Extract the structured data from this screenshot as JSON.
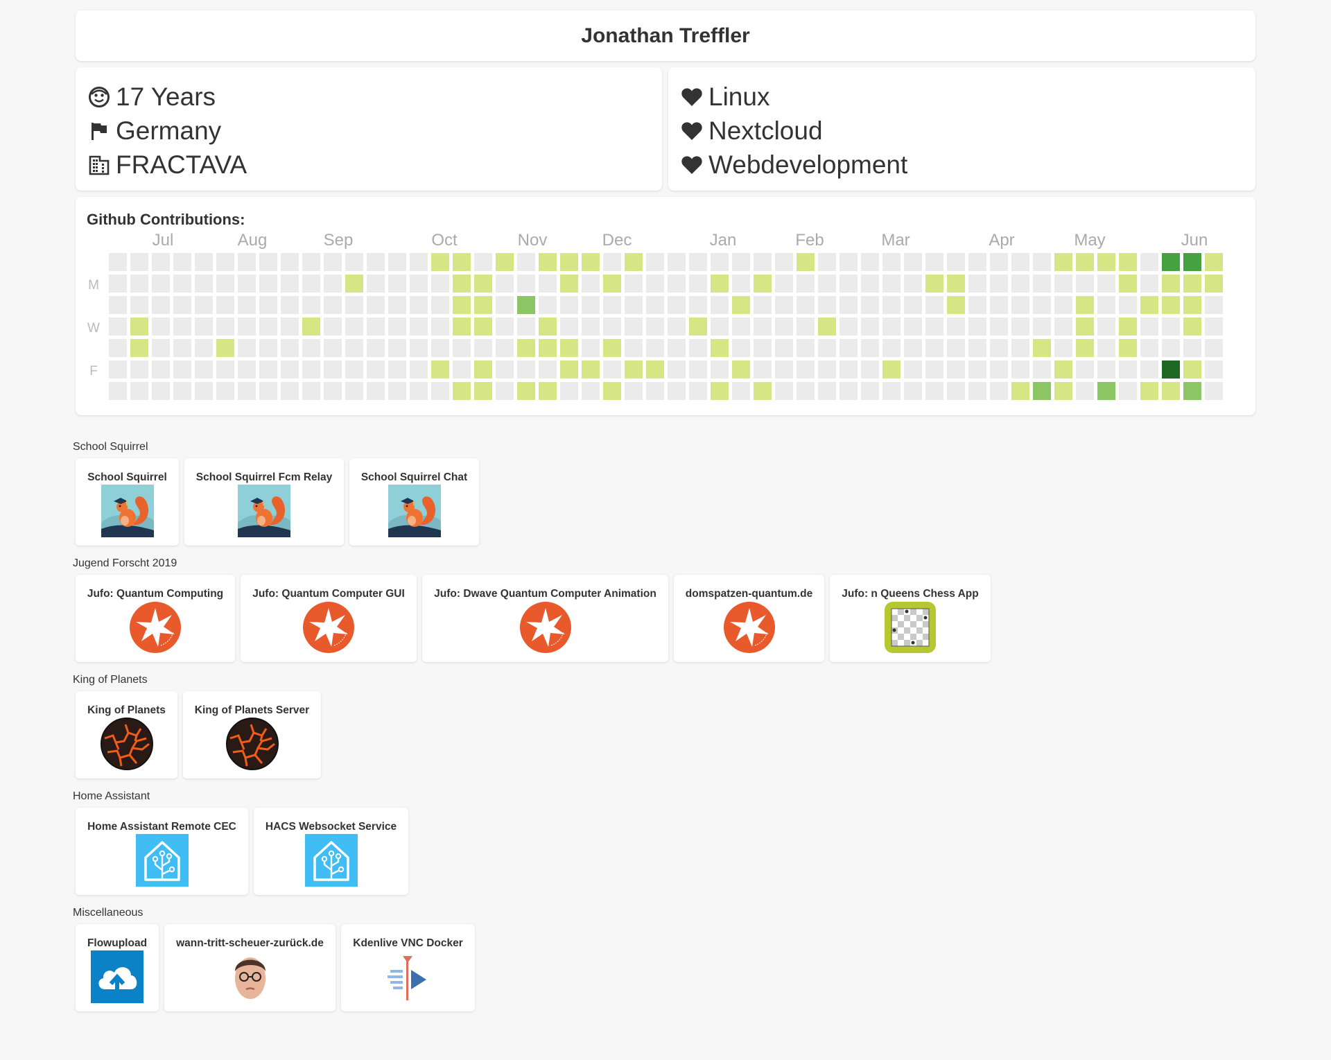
{
  "header": {
    "name": "Jonathan Treffler"
  },
  "info_left": [
    {
      "icon": "smiley-face-icon",
      "text": "17 Years"
    },
    {
      "icon": "flag-icon",
      "text": "Germany"
    },
    {
      "icon": "office-building-icon",
      "text": "FRACTAVA"
    }
  ],
  "info_right": [
    {
      "icon": "heart-icon",
      "text": "Linux"
    },
    {
      "icon": "heart-icon",
      "text": "Nextcloud"
    },
    {
      "icon": "heart-icon",
      "text": "Webdevelopment"
    }
  ],
  "contributions": {
    "title": "Github Contributions:",
    "months": [
      "Jul",
      "Aug",
      "Sep",
      "Oct",
      "Nov",
      "Dec",
      "Jan",
      "Feb",
      "Mar",
      "Apr",
      "May",
      "Jun"
    ],
    "days": [
      "M",
      "W",
      "F"
    ],
    "colors": [
      "#ebebeb",
      "#d6e685",
      "#8cc665",
      "#44a340",
      "#1e6823"
    ],
    "weeks": [
      [
        0,
        0,
        0,
        0,
        0,
        0,
        0
      ],
      [
        0,
        0,
        0,
        1,
        1,
        0,
        0
      ],
      [
        0,
        0,
        0,
        0,
        0,
        0,
        0
      ],
      [
        0,
        0,
        0,
        0,
        0,
        0,
        0
      ],
      [
        0,
        0,
        0,
        0,
        0,
        0,
        0
      ],
      [
        0,
        0,
        0,
        0,
        1,
        0,
        0
      ],
      [
        0,
        0,
        0,
        0,
        0,
        0,
        0
      ],
      [
        0,
        0,
        0,
        0,
        0,
        0,
        0
      ],
      [
        0,
        0,
        0,
        0,
        0,
        0,
        0
      ],
      [
        0,
        0,
        0,
        1,
        0,
        0,
        0
      ],
      [
        0,
        0,
        0,
        0,
        0,
        0,
        0
      ],
      [
        0,
        1,
        0,
        0,
        0,
        0,
        0
      ],
      [
        0,
        0,
        0,
        0,
        0,
        0,
        0
      ],
      [
        0,
        0,
        0,
        0,
        0,
        0,
        0
      ],
      [
        0,
        0,
        0,
        0,
        0,
        0,
        0
      ],
      [
        1,
        0,
        0,
        0,
        0,
        1,
        0
      ],
      [
        1,
        1,
        1,
        1,
        0,
        0,
        1
      ],
      [
        0,
        1,
        1,
        1,
        0,
        1,
        1
      ],
      [
        1,
        0,
        0,
        0,
        0,
        0,
        0
      ],
      [
        0,
        0,
        2,
        0,
        1,
        0,
        1
      ],
      [
        1,
        0,
        0,
        1,
        1,
        0,
        1
      ],
      [
        1,
        1,
        0,
        0,
        1,
        1,
        0
      ],
      [
        1,
        0,
        0,
        0,
        0,
        1,
        0
      ],
      [
        0,
        1,
        0,
        0,
        1,
        0,
        1
      ],
      [
        1,
        0,
        0,
        0,
        0,
        1,
        0
      ],
      [
        0,
        0,
        0,
        0,
        0,
        1,
        0
      ],
      [
        0,
        0,
        0,
        0,
        0,
        0,
        0
      ],
      [
        0,
        0,
        0,
        1,
        0,
        0,
        0
      ],
      [
        0,
        1,
        0,
        0,
        1,
        0,
        1
      ],
      [
        0,
        0,
        1,
        0,
        0,
        1,
        0
      ],
      [
        0,
        1,
        0,
        0,
        0,
        0,
        1
      ],
      [
        0,
        0,
        0,
        0,
        0,
        0,
        0
      ],
      [
        1,
        0,
        0,
        0,
        0,
        0,
        0
      ],
      [
        0,
        0,
        0,
        1,
        0,
        0,
        0
      ],
      [
        0,
        0,
        0,
        0,
        0,
        0,
        0
      ],
      [
        0,
        0,
        0,
        0,
        0,
        0,
        0
      ],
      [
        0,
        0,
        0,
        0,
        0,
        1,
        0
      ],
      [
        0,
        0,
        0,
        0,
        0,
        0,
        0
      ],
      [
        0,
        1,
        0,
        0,
        0,
        0,
        0
      ],
      [
        0,
        1,
        1,
        0,
        0,
        0,
        0
      ],
      [
        0,
        0,
        0,
        0,
        0,
        0,
        0
      ],
      [
        0,
        0,
        0,
        0,
        0,
        0,
        0
      ],
      [
        0,
        0,
        0,
        0,
        0,
        0,
        1
      ],
      [
        0,
        0,
        0,
        0,
        1,
        0,
        2
      ],
      [
        1,
        0,
        0,
        0,
        0,
        1,
        1
      ],
      [
        1,
        0,
        1,
        1,
        1,
        0,
        0
      ],
      [
        1,
        0,
        0,
        0,
        0,
        0,
        2
      ],
      [
        1,
        1,
        0,
        1,
        1,
        0,
        0
      ],
      [
        0,
        0,
        1,
        0,
        0,
        0,
        1
      ],
      [
        3,
        1,
        1,
        0,
        0,
        4,
        1
      ],
      [
        3,
        1,
        1,
        1,
        0,
        1,
        2
      ],
      [
        1,
        1,
        0,
        0,
        0,
        0,
        0
      ]
    ]
  },
  "sections": [
    {
      "title": "School Squirrel",
      "projects": [
        {
          "name": "School Squirrel",
          "icon": "squirrel-icon"
        },
        {
          "name": "School Squirrel Fcm Relay",
          "icon": "squirrel-icon"
        },
        {
          "name": "School Squirrel Chat",
          "icon": "squirrel-icon"
        }
      ]
    },
    {
      "title": "Jugend Forscht 2019",
      "projects": [
        {
          "name": "Jufo: Quantum Computing",
          "icon": "jugend-forscht-logo-icon"
        },
        {
          "name": "Jufo: Quantum Computer GUI",
          "icon": "jugend-forscht-logo-icon"
        },
        {
          "name": "Jufo: Dwave Quantum Computer Animation",
          "icon": "jugend-forscht-logo-icon"
        },
        {
          "name": "domspatzen-quantum.de",
          "icon": "jugend-forscht-logo-icon"
        },
        {
          "name": "Jufo: n Queens Chess App",
          "icon": "chessboard-icon"
        }
      ]
    },
    {
      "title": "King of Planets",
      "projects": [
        {
          "name": "King of Planets",
          "icon": "lava-planet-icon"
        },
        {
          "name": "King of Planets Server",
          "icon": "lava-planet-icon"
        }
      ]
    },
    {
      "title": "Home Assistant",
      "projects": [
        {
          "name": "Home Assistant Remote CEC",
          "icon": "home-assistant-icon"
        },
        {
          "name": "HACS Websocket Service",
          "icon": "home-assistant-icon"
        }
      ]
    },
    {
      "title": "Miscellaneous",
      "projects": [
        {
          "name": "Flowupload",
          "icon": "cloud-upload-icon"
        },
        {
          "name": "wann-tritt-scheuer-zurück.de",
          "icon": "face-portrait-icon"
        },
        {
          "name": "Kdenlive VNC Docker",
          "icon": "kdenlive-icon"
        }
      ]
    }
  ]
}
